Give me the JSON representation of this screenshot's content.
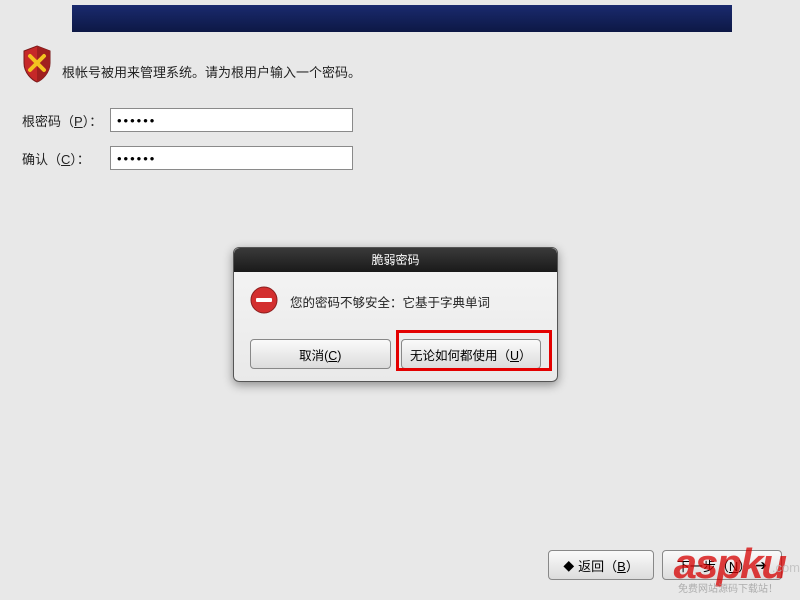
{
  "instruction": "根帐号被用来管理系统。请为根用户输入一个密码。",
  "form": {
    "password_label_prefix": "根密码（",
    "password_mnemonic": "P",
    "password_label_suffix": "）：",
    "confirm_label_prefix": "确认（",
    "confirm_mnemonic": "C",
    "confirm_label_suffix": "）：",
    "password_value": "••••••",
    "confirm_value": "••••••"
  },
  "dialog": {
    "title": "脆弱密码",
    "message": "您的密码不够安全：它基于字典单词",
    "cancel_prefix": "取消(",
    "cancel_mnemonic": "C",
    "cancel_suffix": ")",
    "use_prefix": "无论如何都使用（",
    "use_mnemonic": "U",
    "use_suffix": "）"
  },
  "nav": {
    "back_prefix": "返回（",
    "back_mnemonic": "B",
    "back_suffix": "）",
    "next_prefix": "下一步（",
    "next_mnemonic": "N",
    "next_suffix": "）"
  },
  "watermark": {
    "logo": "aspku",
    "com": ".com",
    "sub": "免费网站源码下载站！"
  }
}
